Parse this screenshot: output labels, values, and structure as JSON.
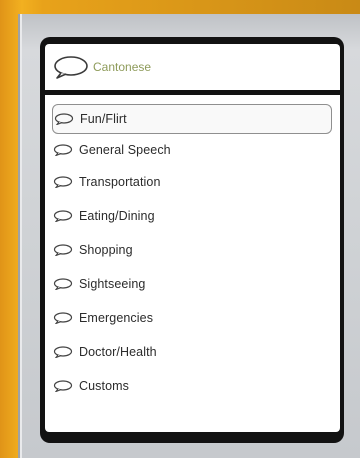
{
  "header": {
    "title": "Cantonese",
    "icon": "speech-bubble-icon"
  },
  "categories": [
    {
      "label": "Fun/Flirt",
      "selected": true
    },
    {
      "label": "General Speech",
      "selected": false
    },
    {
      "label": "Transportation",
      "selected": false
    },
    {
      "label": "Eating/Dining",
      "selected": false
    },
    {
      "label": "Shopping",
      "selected": false
    },
    {
      "label": "Sightseeing",
      "selected": false
    },
    {
      "label": "Emergencies",
      "selected": false
    },
    {
      "label": "Doctor/Health",
      "selected": false
    },
    {
      "label": "Customs",
      "selected": false
    }
  ],
  "colors": {
    "title": "#8e9b5a",
    "panel": "#121212",
    "frame_orange": "#e8a21a"
  }
}
